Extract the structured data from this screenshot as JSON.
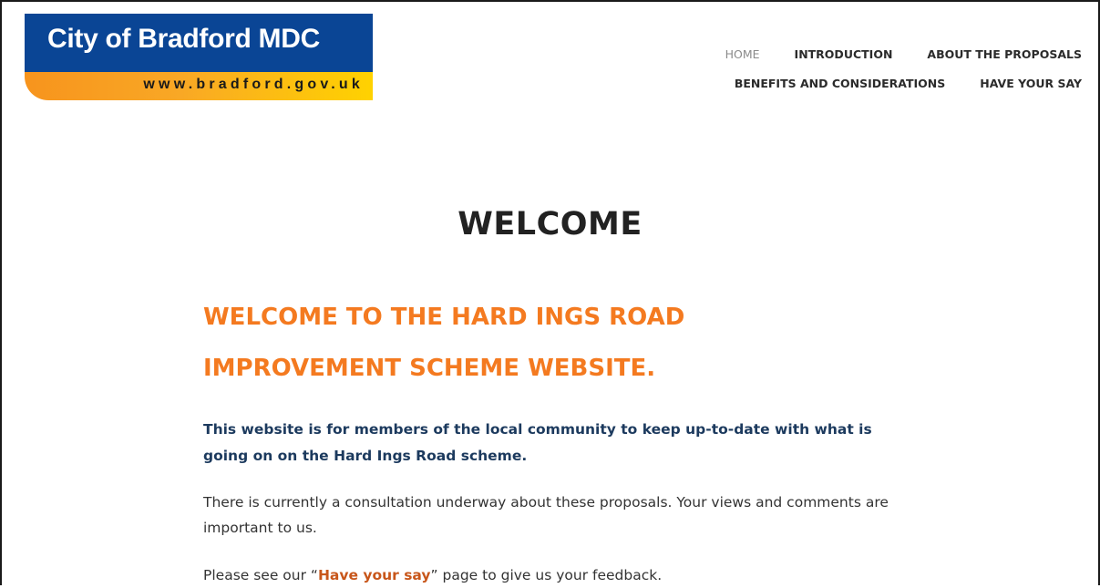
{
  "logo": {
    "title": "City of Bradford MDC",
    "url": "www.bradford.gov.uk"
  },
  "nav": {
    "row1": [
      {
        "label": "HOME",
        "active": true
      },
      {
        "label": "INTRODUCTION",
        "active": false
      },
      {
        "label": "ABOUT THE PROPOSALS",
        "active": false
      }
    ],
    "row2": [
      {
        "label": "BENEFITS AND CONSIDERATIONS",
        "active": false
      },
      {
        "label": "HAVE YOUR SAY",
        "active": false
      }
    ]
  },
  "main": {
    "heading": "WELCOME",
    "subtitle_line1": "WELCOME TO THE HARD INGS ROAD",
    "subtitle_line2": "IMPROVEMENT SCHEME WEBSITE.",
    "intro": "This website is for members of the local community to keep up-to-date with what is going on on the Hard Ings Road scheme.",
    "para1": "There is currently a consultation underway about these proposals. Your views and comments are important to us.",
    "para2_before": "Please see our “",
    "para2_link": "Have your say",
    "para2_after": "” page to give us your feedback."
  },
  "colors": {
    "logo_blue": "#0a4595",
    "accent_orange": "#f47a20",
    "link_orange": "#c8561a",
    "intro_navy": "#1c3a5e"
  }
}
